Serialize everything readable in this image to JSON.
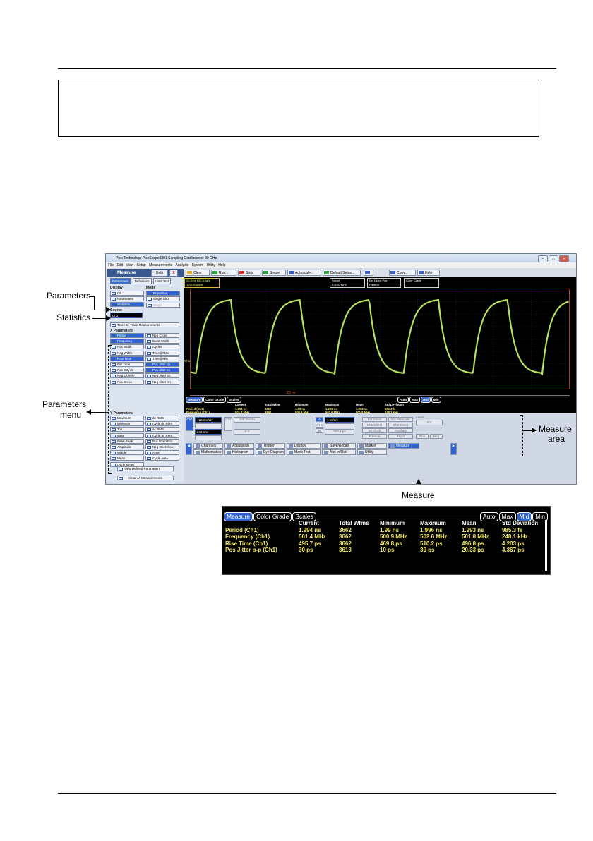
{
  "app": {
    "title": "Pico Technology   PicoScope9301   Sampling Oscilloscope 20 GHz",
    "window_buttons": [
      "–",
      "□",
      "✕"
    ],
    "menu": [
      "File",
      "Edit",
      "View",
      "Setup",
      "Measurements",
      "Analysis",
      "System",
      "Utility",
      "Help"
    ]
  },
  "left_panel": {
    "title": "Measure",
    "help_label": "Help",
    "close_label": "X",
    "tabs": [
      "Parameters",
      "Definitions",
      "Limit Test"
    ],
    "display_label": "Display",
    "mode_label": "Mode",
    "display_buttons": [
      "Off",
      "Parameters",
      "Statistics"
    ],
    "mode_buttons": [
      "Repetitive",
      "Single Shot",
      "Single"
    ],
    "source_label": "Source",
    "source_value": "Ch1",
    "trace_btn": "Trace-to-Trace Measurements",
    "x_label": "X Parameters",
    "x_params": [
      [
        "Period",
        "Neg Cross"
      ],
      [
        "Frequency",
        "Burst Width"
      ],
      [
        "Pos Width",
        "Cycles"
      ],
      [
        "Neg Width",
        "Time@Max"
      ],
      [
        "Rise Time",
        "Time@Min"
      ],
      [
        "Fall Time",
        "Pos Jitter pp"
      ],
      [
        "Pos DCycle",
        "Pos Jitter rm"
      ],
      [
        "Neg DCycle",
        "Neg Jitter pp"
      ],
      [
        "Pos Cross",
        "Neg Jitter rm"
      ]
    ],
    "y_label": "Y Parameters",
    "y_params": [
      [
        "Maximum",
        "dc RMS"
      ],
      [
        "Minimum",
        "Cycle dc RMS"
      ],
      [
        "Top",
        "ac RMS"
      ],
      [
        "Base",
        "Cycle ac RMS"
      ],
      [
        "Peak-Peak",
        "Pos Overshoo"
      ],
      [
        "Amplitude",
        "Neg Overshoo"
      ],
      [
        "Middle",
        "Area"
      ],
      [
        "Mean",
        "Cycle Area"
      ],
      [
        "Cycle Mean",
        ""
      ]
    ],
    "view_btn": "View Defined Parameters",
    "clear_btn": "Clear All Measurements"
  },
  "toolbar": [
    "Clear",
    "Run...",
    "Stop",
    "Single",
    "Autoscale...",
    "Default Setup...",
    "Copy...",
    "Help"
  ],
  "screen": {
    "info_boxes": [
      {
        "l1": "20 GHz   100 GSa/s",
        "l2": "1 KS      Sample"
      },
      {
        "l1": "Scope",
        "l2": "F=100 MHz"
      },
      {
        "l1": "Ext Direct    Pos",
        "l2": "Freerun"
      },
      {
        "l1": "Color Grade",
        "l2": ""
      }
    ],
    "ch_label": "Ch1",
    "timebase": "20 ns"
  },
  "measure": {
    "tabs": [
      "Measure",
      "Color Grade",
      "Scales"
    ],
    "right_tabs": [
      "Auto",
      "Max",
      "Mid",
      "Min"
    ],
    "headers": [
      "",
      "Current",
      "Total Wfms",
      "Minimum",
      "Maximum",
      "Mean",
      "Std Deviation"
    ],
    "rows": [
      [
        "Period (Ch1)",
        "1.994 ns",
        "3662",
        "1.99 ns",
        "1.996 ns",
        "1.993 ns",
        "985.3 fs"
      ],
      [
        "Frequency (Ch1)",
        "501.4 MHz",
        "3662",
        "500.9 MHz",
        "502.6 MHz",
        "501.8 MHz",
        "248.1 kHz"
      ],
      [
        "Rise Time (Ch1)",
        "495.7 ps",
        "3662",
        "469.8 ps",
        "510.2 ps",
        "496.8 ps",
        "4.203 ps"
      ],
      [
        "Pos Jitter p-p (Ch1)",
        "30 ps",
        "3613",
        "10 ps",
        "30 ps",
        "20.33 ps",
        "4.367 ps"
      ]
    ]
  },
  "controls": {
    "ch1": "Ch1",
    "ch2": "Ch2",
    "ch1_scale": "102 mV/div",
    "ch1_offset": "242 mV",
    "ch2_scale": "100 mV/div",
    "ch2_offset": "0 V",
    "tb_scale": "1 ns/div",
    "tb_pos": "983.4 ps",
    "ab": [
      "A",
      "A+B",
      "B"
    ],
    "trig": [
      "Ext Direct",
      "Ext Prescaler",
      "Ch1 Direct",
      "Ch2 Direct",
      "Int Clock",
      "Auxiliary",
      "Freerun",
      "Trig'd"
    ],
    "level_label": "Level",
    "level_value": "0 V",
    "pos": "Pos",
    "neg": "Neg",
    "nav_row1": [
      "Channels",
      "Acquisition",
      "Trigger",
      "Display",
      "Save/Recall",
      "Marker",
      "Measure"
    ],
    "nav_row2": [
      "Mathematics",
      "Histogram",
      "Eye Diagram",
      "Mask Test",
      "Aux In/Out",
      "Utility"
    ]
  },
  "callouts": {
    "parameters": "Parameters",
    "statistics": "Statistics",
    "params_menu_1": "Parameters",
    "params_menu_2": "menu",
    "measure_area_1": "Measure",
    "measure_area_2": "area",
    "measure": "Measure"
  }
}
